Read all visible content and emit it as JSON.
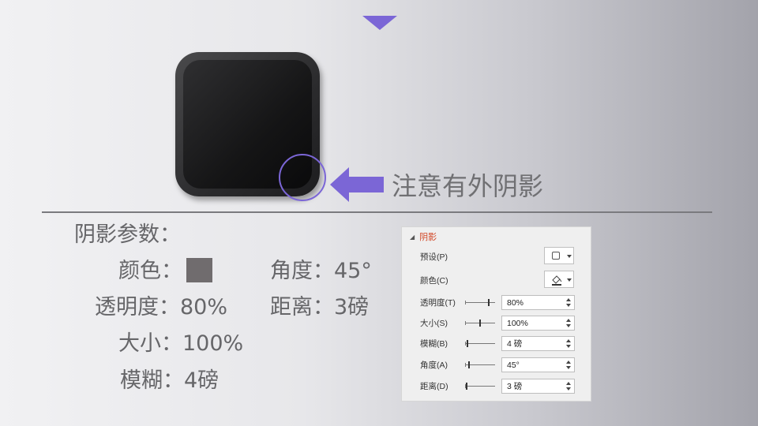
{
  "callout": {
    "text": "注意有外阴影"
  },
  "params": {
    "heading": "阴影参数：",
    "color_label": "颜色：",
    "color_value": "#706c6e",
    "transparency": "透明度：80%",
    "size": "大小：100%",
    "blur": "模糊：4磅",
    "angle": "角度：45°",
    "distance": "距离：3磅"
  },
  "panel": {
    "title": "阴影",
    "preset_label": "预设(P)",
    "color_label": "颜色(C)",
    "rows": [
      {
        "label": "透明度(T)",
        "value": "80%",
        "level": 0.8
      },
      {
        "label": "大小(S)",
        "value": "100%",
        "level": 0.5
      },
      {
        "label": "模糊(B)",
        "value": "4 磅",
        "level": 0.05
      },
      {
        "label": "角度(A)",
        "value": "45°",
        "level": 0.12
      },
      {
        "label": "距离(D)",
        "value": "3 磅",
        "level": 0.03
      }
    ]
  },
  "colors": {
    "accent": "#7b66d6",
    "panel_title": "#d24726"
  },
  "icons": {
    "top": "triangle-down-icon",
    "callout_arrow": "arrow-left-icon"
  }
}
